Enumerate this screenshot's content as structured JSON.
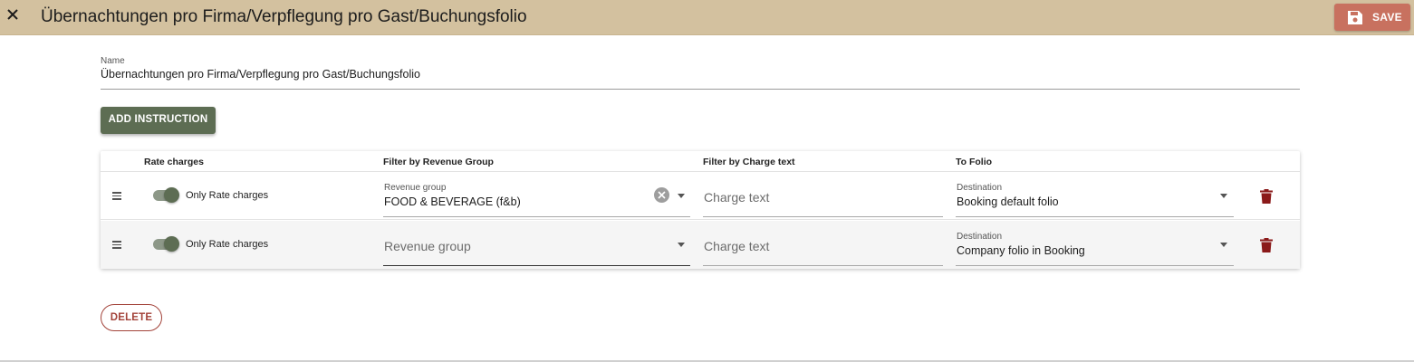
{
  "header": {
    "title": "Übernachtungen pro Firma/Verpflegung pro Gast/Buchungsfolio",
    "save_label": "SAVE",
    "close_icon": "close-icon",
    "save_icon": "floppy-disk-icon",
    "background_color": "#d3c19f",
    "save_color": "#c8715f"
  },
  "form": {
    "name_label": "Name",
    "name_value": "Übernachtungen pro Firma/Verpflegung pro Gast/Buchungsfolio",
    "add_instruction_label": "ADD INSTRUCTION",
    "delete_label": "DELETE",
    "accent_color": "#5d6d53",
    "danger_color": "#a3433a"
  },
  "table": {
    "columns": [
      "Rate charges",
      "Filter by Revenue Group",
      "Filter by Charge text",
      "To Folio"
    ],
    "rows": [
      {
        "toggle_on": true,
        "toggle_label": "Only Rate charges",
        "revenue_group_label": "Revenue group",
        "revenue_group_value": "FOOD & BEVERAGE (f&b)",
        "charge_text_placeholder": "Charge text",
        "destination_label": "Destination",
        "destination_value": "Booking default folio"
      },
      {
        "toggle_on": true,
        "toggle_label": "Only Rate charges",
        "revenue_group_placeholder": "Revenue group",
        "charge_text_placeholder": "Charge text",
        "destination_label": "Destination",
        "destination_value": "Company folio in Booking"
      }
    ]
  }
}
